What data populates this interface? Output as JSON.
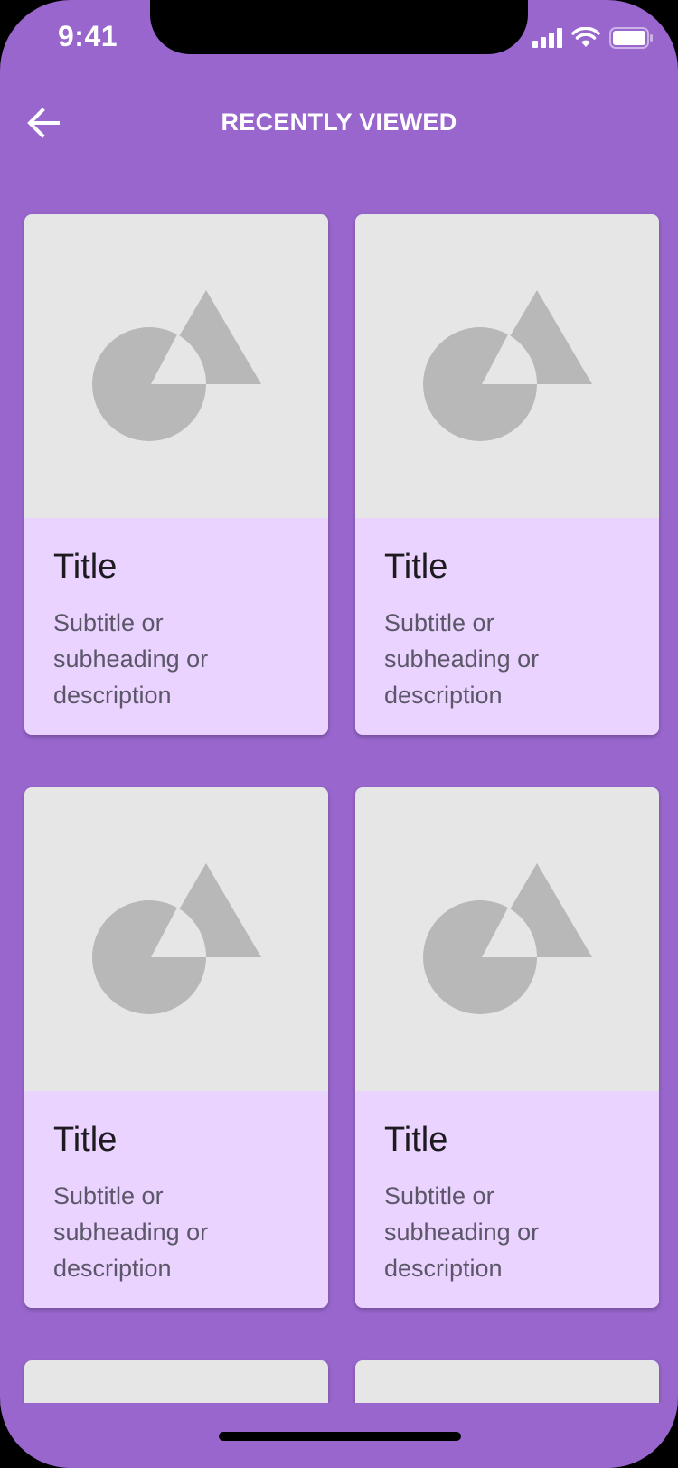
{
  "status_bar": {
    "time": "9:41",
    "icons": [
      "signal-icon",
      "wifi-icon",
      "battery-icon"
    ]
  },
  "header": {
    "title": "RECENTLY VIEWED",
    "back_icon": "arrow-left-icon"
  },
  "cards": [
    {
      "title": "Title",
      "subtitle": "Subtitle or subheading or description",
      "image_icon": "image-placeholder-icon"
    },
    {
      "title": "Title",
      "subtitle": "Subtitle or subheading or description",
      "image_icon": "image-placeholder-icon"
    },
    {
      "title": "Title",
      "subtitle": "Subtitle or subheading or description",
      "image_icon": "image-placeholder-icon"
    },
    {
      "title": "Title",
      "subtitle": "Subtitle or subheading or description",
      "image_icon": "image-placeholder-icon"
    }
  ],
  "colors": {
    "background": "#9866cc",
    "card_body": "#ead3ff",
    "card_media": "#e6e6e6",
    "placeholder_shape": "#b8b8b8"
  }
}
